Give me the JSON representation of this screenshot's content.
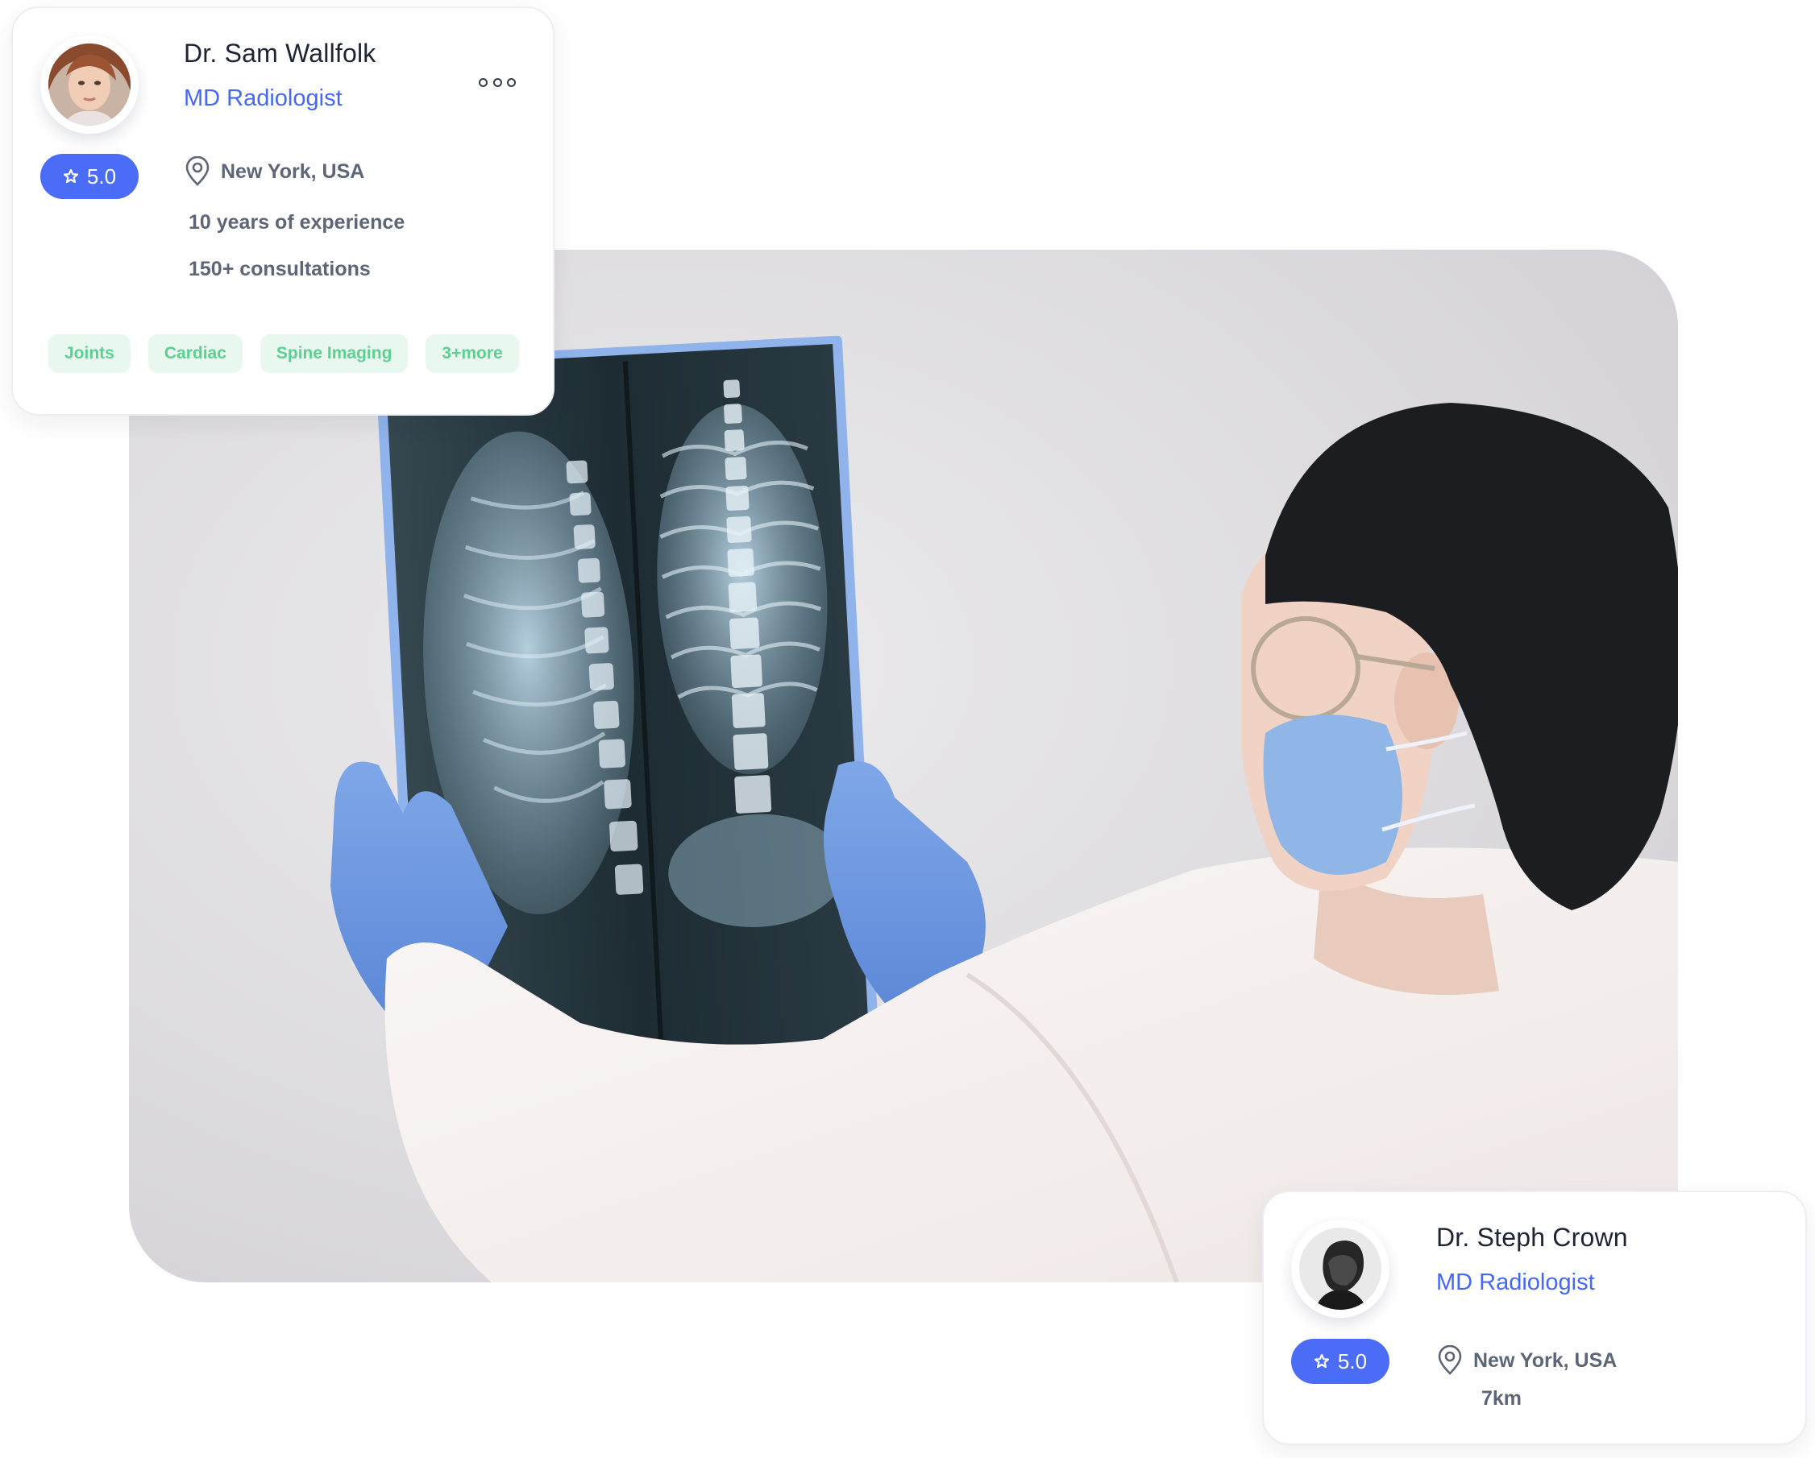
{
  "doctor_primary": {
    "name": "Dr. Sam Wallfolk",
    "role": "MD Radiologist",
    "rating": "5.0",
    "location": "New York, USA",
    "experience": "10 years of experience",
    "consultations": "150+ consultations",
    "tags": [
      "Joints",
      "Cardiac",
      "Spine Imaging",
      "3+more"
    ],
    "more_icon": "more-horizontal-icon"
  },
  "doctor_secondary": {
    "name": "Dr. Steph Crown",
    "role": "MD Radiologist",
    "rating": "5.0",
    "location": "New York, USA",
    "distance": "7km"
  },
  "icons": {
    "rating": "star-icon",
    "location": "map-pin-icon"
  },
  "colors": {
    "accent": "#4a6cf7",
    "role_text": "#4468f5",
    "tag_bg": "#e9f8ef",
    "tag_text": "#5fce92",
    "muted_text": "#5d6677",
    "heading_text": "#1d2433"
  }
}
